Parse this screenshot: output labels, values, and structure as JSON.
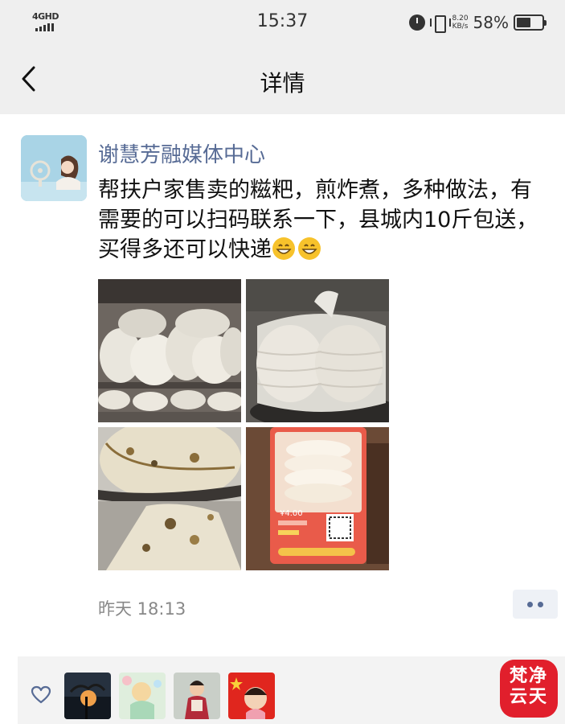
{
  "status_bar": {
    "network": "4GHD",
    "time": "15:37",
    "speed_value": "8.20",
    "speed_unit": "KB/s",
    "battery_percent": "58%",
    "battery_level": 0.58,
    "icons": [
      "signal-icon",
      "alarm-icon",
      "vibrate-icon",
      "battery-icon"
    ]
  },
  "nav": {
    "title": "详情",
    "back_icon": "chevron-left-icon"
  },
  "post": {
    "author": "谢慧芳融媒体中心",
    "text": "帮扶户家售卖的糍粑，煎炸煮，多种做法，有需要的可以扫码联系一下，县城内10斤包送，买得多还可以快递",
    "emojis": [
      "grinning-face",
      "grinning-face"
    ],
    "time": "昨天 18:13",
    "more_icon": "more-dots-icon",
    "photos": [
      {
        "subject": "stacked-rice-cakes-on-shelf"
      },
      {
        "subject": "rice-cakes-in-plastic-bag"
      },
      {
        "subject": "fried-rice-cake-closeup"
      },
      {
        "subject": "rice-cakes-with-price-card"
      }
    ],
    "photo_card": {
      "price": "¥4.00"
    }
  },
  "likes": {
    "heart_icon": "heart-outline-icon",
    "likers": [
      "sunset-avatar",
      "cartoon-avatar",
      "girl-avatar",
      "flag-child-avatar"
    ]
  },
  "watermark": {
    "line1": "梵净",
    "line2": "云天"
  },
  "colors": {
    "bar_background": "#efefef",
    "author_name": "#576b95",
    "timestamp": "#888888",
    "watermark": "#e11f2c"
  }
}
